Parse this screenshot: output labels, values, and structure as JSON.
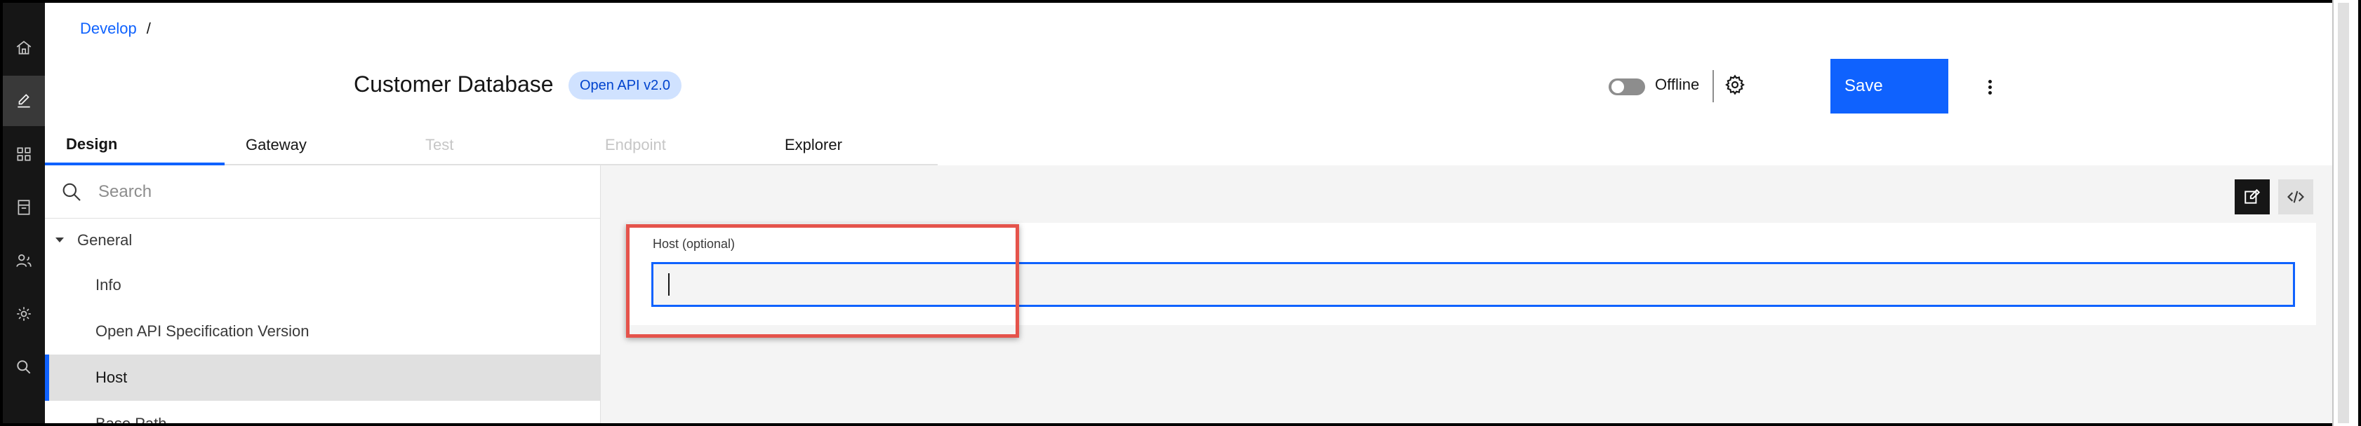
{
  "breadcrumb": {
    "root": "Develop",
    "separator": "/"
  },
  "header": {
    "title": "Customer Database",
    "tag": "Open API v2.0",
    "toggle_label": "Offline",
    "toggle_state": "off",
    "save_label": "Save"
  },
  "tabs": [
    {
      "label": "Design",
      "state": "active"
    },
    {
      "label": "Gateway",
      "state": "enabled"
    },
    {
      "label": "Test",
      "state": "disabled"
    },
    {
      "label": "Endpoint",
      "state": "disabled"
    },
    {
      "label": "Explorer",
      "state": "enabled"
    }
  ],
  "sidebar": {
    "search_placeholder": "Search",
    "group_label": "General",
    "items": [
      {
        "label": "Info"
      },
      {
        "label": "Open API Specification Version"
      },
      {
        "label": "Host",
        "selected": true
      },
      {
        "label": "Base Path"
      }
    ]
  },
  "form": {
    "host_label": "Host (optional)",
    "host_value": ""
  },
  "rail_icons": [
    "home-icon",
    "edit-icon",
    "apps-icon",
    "catalog-icon",
    "users-icon",
    "settings-icon",
    "search-icon"
  ],
  "colors": {
    "accent": "#0f62fe",
    "highlight": "#e5534b",
    "rail": "#161616"
  }
}
